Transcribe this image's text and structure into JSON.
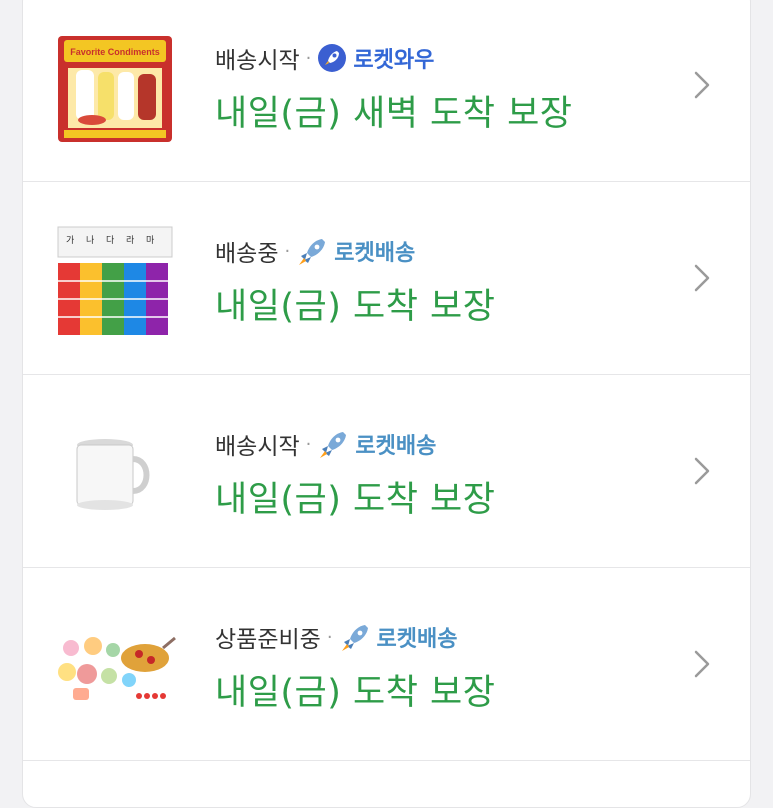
{
  "orders": [
    {
      "status": "배송시작",
      "badge": "로켓와우",
      "badge_color": "#3367d6",
      "badge_icon": "rocket-circle-icon",
      "eta": "내일(금) 새벽 도착 보장",
      "thumb": "favorite-condiments-toy-image"
    },
    {
      "status": "배송중",
      "badge": "로켓배송",
      "badge_color": "#4a90c4",
      "badge_icon": "rocket-icon",
      "eta": "내일(금) 도착 보장",
      "thumb": "korean-letter-blocks-image"
    },
    {
      "status": "배송시작",
      "badge": "로켓배송",
      "badge_color": "#4a90c4",
      "badge_icon": "rocket-icon",
      "eta": "내일(금) 도착 보장",
      "thumb": "white-mug-image"
    },
    {
      "status": "상품준비중",
      "badge": "로켓배송",
      "badge_color": "#4a90c4",
      "badge_icon": "rocket-icon",
      "eta": "내일(금) 도착 보장",
      "thumb": "toy-food-set-image"
    }
  ],
  "colors": {
    "eta_green": "#2e9c48",
    "status_text": "#333333",
    "chevron": "#9a9a9a"
  }
}
